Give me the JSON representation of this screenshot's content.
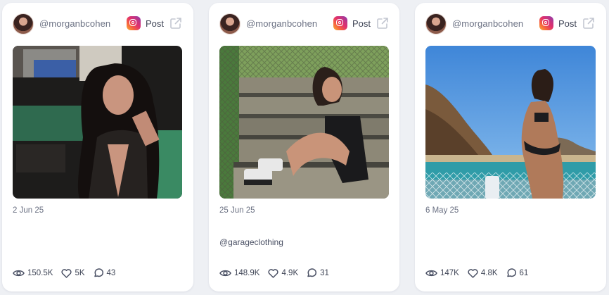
{
  "posts": [
    {
      "handle": "@morganbcohen",
      "platform_label": "Post",
      "platform_icon": "instagram-icon",
      "date": "2 Jun 25",
      "caption": "",
      "views": "150.5K",
      "likes": "5K",
      "comments": "43"
    },
    {
      "handle": "@morganbcohen",
      "platform_label": "Post",
      "platform_icon": "instagram-icon",
      "date": "25 Jun 25",
      "caption": "@garageclothing",
      "views": "148.9K",
      "likes": "4.9K",
      "comments": "31"
    },
    {
      "handle": "@morganbcohen",
      "platform_label": "Post",
      "platform_icon": "instagram-icon",
      "date": "6 May 25",
      "caption": "",
      "views": "147K",
      "likes": "4.8K",
      "comments": "61"
    }
  ],
  "colors": {
    "page_bg": "#eef0f4",
    "card_bg": "#ffffff",
    "muted_text": "#6b7183",
    "body_text": "#3f4556"
  }
}
